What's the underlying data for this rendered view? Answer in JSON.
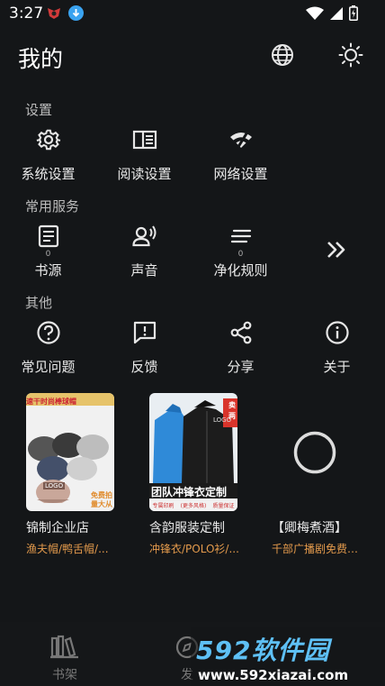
{
  "status_bar": {
    "time": "3:27"
  },
  "header": {
    "title": "我的",
    "globe_icon": "globe-icon",
    "theme_icon": "sun-icon"
  },
  "sections": {
    "settings": {
      "label": "设置",
      "items": [
        {
          "label": "系统设置",
          "icon": "gear-icon"
        },
        {
          "label": "阅读设置",
          "icon": "book-layout-icon"
        },
        {
          "label": "网络设置",
          "icon": "wifi-off-icon"
        }
      ]
    },
    "services": {
      "label": "常用服务",
      "items": [
        {
          "label": "书源",
          "count": "0",
          "icon": "document-icon"
        },
        {
          "label": "声音",
          "count": "",
          "icon": "voice-icon"
        },
        {
          "label": "净化规则",
          "count": "0",
          "icon": "filter-icon"
        }
      ],
      "more_icon": "double-chevron-right-icon"
    },
    "other": {
      "label": "其他",
      "items": [
        {
          "label": "常见问题",
          "icon": "help-icon"
        },
        {
          "label": "反馈",
          "icon": "feedback-icon"
        },
        {
          "label": "分享",
          "icon": "share-icon"
        },
        {
          "label": "关于",
          "icon": "info-icon"
        }
      ]
    }
  },
  "ads": [
    {
      "name": "锦制企业店",
      "tags": "渔夫帽/鸭舌帽/...",
      "image_text": [
        "速干时尚棒球帽",
        "免费拍",
        "量大从",
        "LOGO"
      ]
    },
    {
      "name": "含韵服装定制",
      "tags": "冲锋衣/POLO衫/...",
      "image_text": [
        "团队冲锋衣定制",
        "专属印刷",
        "(更多风格)",
        "质量保证",
        "卖",
        "两",
        "LOGO"
      ]
    },
    {
      "name": "【卿梅煮酒】",
      "tags": "千部广播剧免费…"
    }
  ],
  "bottom_nav": [
    {
      "label": "书架",
      "icon": "bookshelf-icon"
    },
    {
      "label": "发",
      "icon": "discover-icon"
    }
  ],
  "watermark": {
    "title": "592软件园",
    "url": "www.592xiazai.com"
  },
  "colors": {
    "background": "#141618",
    "accent_tag": "#e39a4c",
    "watermark": "#5ec0f5"
  }
}
